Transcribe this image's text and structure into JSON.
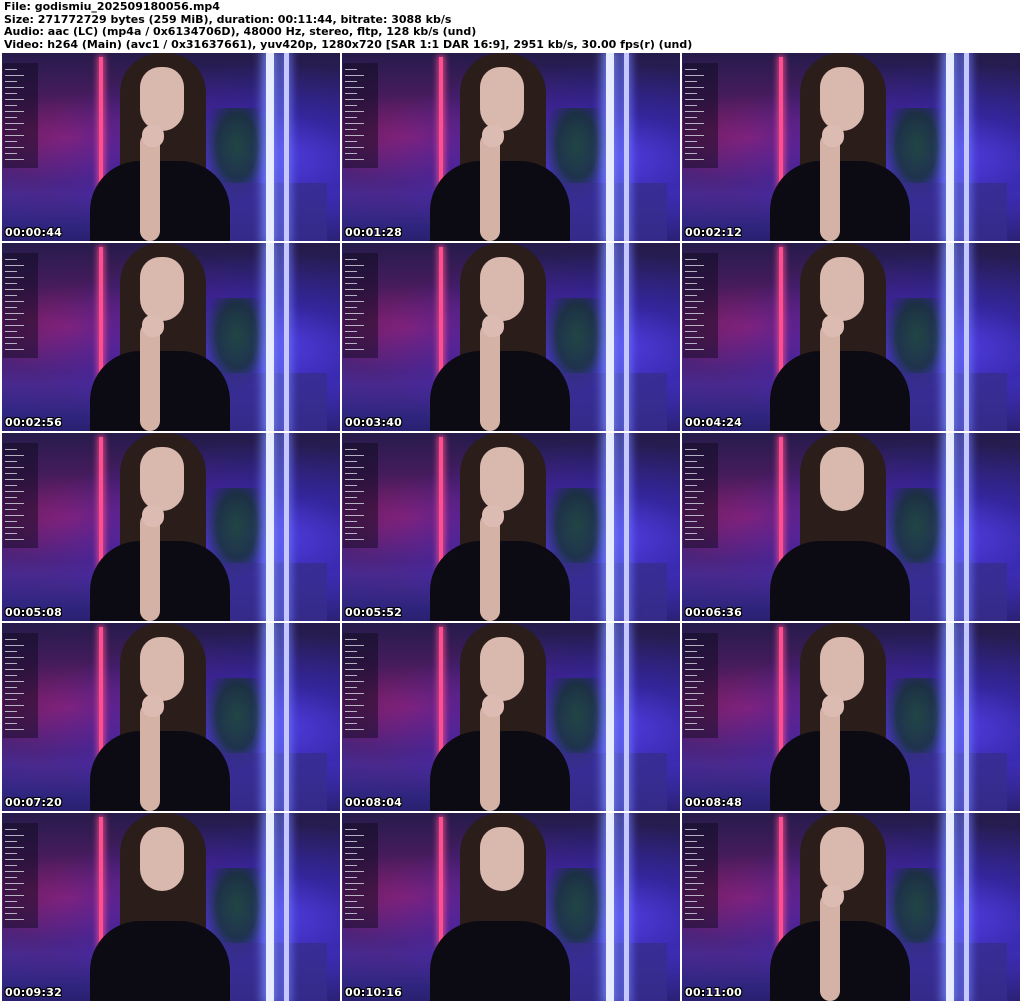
{
  "header": {
    "file": "File: godismiu_202509180056.mp4",
    "size": "Size: 271772729 bytes (259 MiB), duration: 00:11:44, bitrate: 3088 kb/s",
    "audio": "Audio: aac (LC) (mp4a / 0x6134706D), 48000 Hz, stereo, fltp, 128 kb/s (und)",
    "video": "Video: h264 (Main) (avc1 / 0x31637661), yuv420p, 1280x720 [SAR 1:1 DAR 16:9], 2951 kb/s, 30.00 fps(r) (und)"
  },
  "thumbnails": [
    {
      "timestamp": "00:00:44"
    },
    {
      "timestamp": "00:01:28"
    },
    {
      "timestamp": "00:02:12"
    },
    {
      "timestamp": "00:02:56"
    },
    {
      "timestamp": "00:03:40"
    },
    {
      "timestamp": "00:04:24"
    },
    {
      "timestamp": "00:05:08"
    },
    {
      "timestamp": "00:05:52"
    },
    {
      "timestamp": "00:06:36"
    },
    {
      "timestamp": "00:07:20"
    },
    {
      "timestamp": "00:08:04"
    },
    {
      "timestamp": "00:08:48"
    },
    {
      "timestamp": "00:09:32"
    },
    {
      "timestamp": "00:10:16"
    },
    {
      "timestamp": "00:11:00"
    }
  ],
  "colors": {
    "background": "#ffffff",
    "neon_pink": "#ff4f8f",
    "neon_blue": "#e8ecff",
    "room_purple": "#2d2470",
    "timestamp_text": "#ffffff"
  }
}
